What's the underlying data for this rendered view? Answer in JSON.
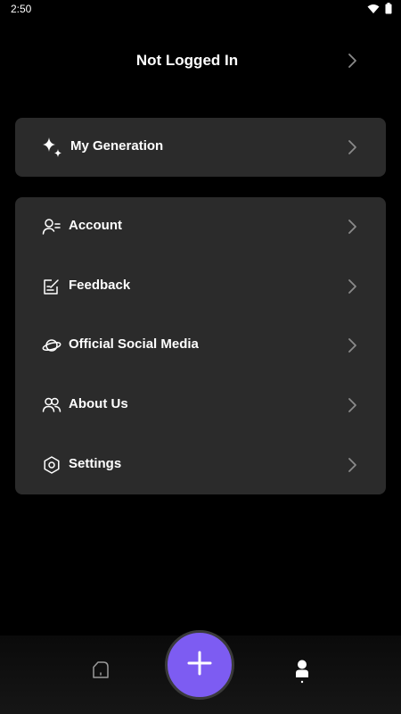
{
  "status_bar": {
    "time": "2:50",
    "icons": [
      "wifi-icon",
      "battery-icon"
    ]
  },
  "header": {
    "title": "Not Logged In",
    "chevron_icon": "chevron-right-icon"
  },
  "generation_card": {
    "icon": "sparkle-icon",
    "label": "My Generation"
  },
  "menu": {
    "items": [
      {
        "id": "account",
        "label": "Account",
        "icon": "account-icon"
      },
      {
        "id": "feedback",
        "label": "Feedback",
        "icon": "feedback-icon"
      },
      {
        "id": "social",
        "label": "Official Social Media",
        "icon": "planet-icon"
      },
      {
        "id": "about",
        "label": "About Us",
        "icon": "people-icon"
      },
      {
        "id": "settings",
        "label": "Settings",
        "icon": "settings-hex-icon"
      }
    ]
  },
  "bottom_nav": {
    "home_icon": "home-icon",
    "create_icon": "plus-icon",
    "profile_icon": "profile-icon",
    "active": "profile"
  },
  "colors": {
    "background": "#000000",
    "card": "#2b2b2b",
    "accent": "#7d5cf2",
    "text": "#ffffff",
    "muted": "#8a8a8a"
  }
}
